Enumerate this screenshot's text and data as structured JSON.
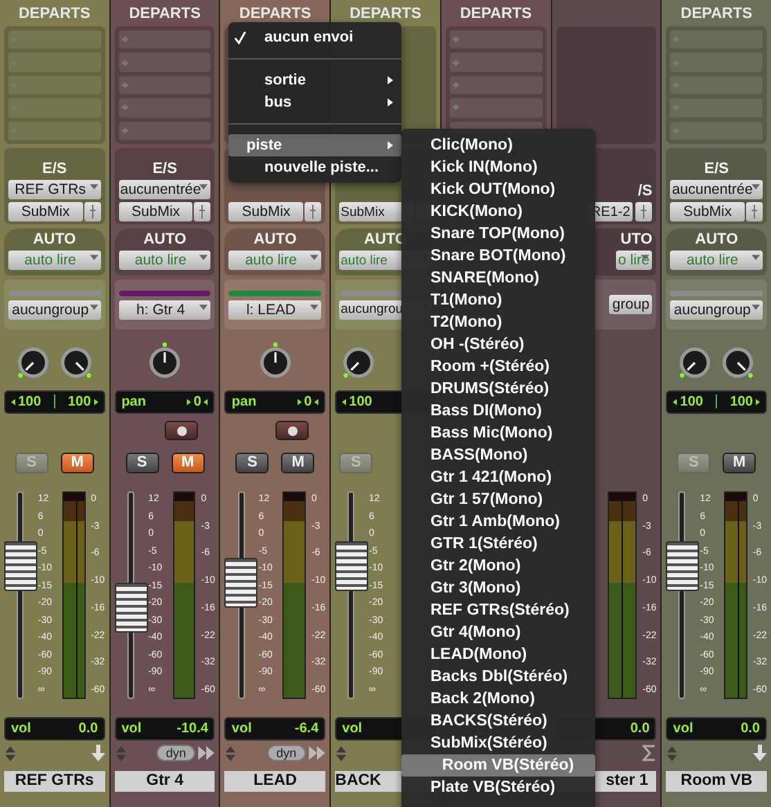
{
  "strips": [
    {
      "color": "#7d7d50",
      "header": "DEPARTS",
      "sends": [
        {
          "kind": "slot"
        },
        {
          "kind": "slot"
        },
        {
          "kind": "slot"
        },
        {
          "kind": "slot"
        },
        {
          "kind": "slot"
        }
      ],
      "io_label": "E/S",
      "input": "REF GTRs",
      "output": "SubMix",
      "auto_label": "AUTO",
      "auto": "auto lire",
      "group": {
        "label": "aucungroup",
        "color": "#8c8c8c"
      },
      "knobs": [
        {
          "kind": "left"
        },
        {
          "kind": "right"
        }
      ],
      "pan": {
        "kind": "width",
        "values": [
          "100",
          "100"
        ]
      },
      "solo": {
        "label": "S",
        "disabled": true
      },
      "mute": {
        "label": "M",
        "on": true
      },
      "level": 0.7,
      "fader_scale": [
        "12",
        "6",
        "0",
        "-5",
        "-10",
        "-15",
        "-20",
        "-30",
        "-40",
        "-60",
        "-90",
        "∞"
      ],
      "meter": {
        "kind": "stereo",
        "scale": [
          "0",
          "-3",
          "-6",
          "-10",
          "-16",
          "-22",
          "-32",
          "-60"
        ]
      },
      "vol_label": "vol",
      "vol": "0.0",
      "bottom": {
        "kind": "send"
      },
      "name": "REF GTRs"
    },
    {
      "color": "#6b5053",
      "header": "DEPARTS",
      "sends": [
        {
          "kind": "slot"
        },
        {
          "kind": "slot"
        },
        {
          "kind": "slot"
        },
        {
          "kind": "slot"
        },
        {
          "kind": "slot"
        }
      ],
      "io_label": "E/S",
      "input": "aucunentrée",
      "output": "SubMix",
      "auto_label": "AUTO",
      "auto": "auto lire",
      "group": {
        "label": "h: Gtr 4",
        "color": "#6a1a6a"
      },
      "knobs": [
        {
          "kind": "center"
        }
      ],
      "pan": {
        "kind": "pan",
        "label": "pan",
        "values": [
          "0"
        ]
      },
      "record": true,
      "solo": {
        "label": "S",
        "disabled": false
      },
      "mute": {
        "label": "M",
        "on": true
      },
      "level": 0.45,
      "fader_scale": [
        "12",
        "6",
        "0",
        "-5",
        "-10",
        "-15",
        "-20",
        "-30",
        "-40",
        "-60",
        "-90",
        "∞"
      ],
      "meter": {
        "kind": "mono",
        "scale": [
          "0",
          "-3",
          "-6",
          "-10",
          "-16",
          "-22",
          "-32",
          "-60"
        ]
      },
      "vol_label": "vol",
      "vol": "-10.4",
      "bottom": {
        "kind": "dyn",
        "label": "dyn"
      },
      "name": "Gtr 4"
    },
    {
      "color": "#86685a",
      "header": "DEPARTS",
      "output": "SubMix",
      "auto_label": "AUTO",
      "auto": "auto lire",
      "group": {
        "label": "l: LEAD",
        "color": "#1e8a3a"
      },
      "knobs": [
        {
          "kind": "center"
        }
      ],
      "pan": {
        "kind": "pan",
        "label": "pan",
        "values": [
          "0"
        ]
      },
      "record": true,
      "solo": {
        "label": "S",
        "disabled": false
      },
      "mute": {
        "label": "M",
        "on": false
      },
      "level": 0.6,
      "fader_scale": [
        "12",
        "6",
        "0",
        "-5",
        "-10",
        "-15",
        "-20",
        "-30",
        "-40",
        "-60",
        "-90",
        "∞"
      ],
      "meter": {
        "kind": "mono",
        "scale": [
          "0",
          "-3",
          "-6",
          "-10",
          "-16",
          "-22",
          "-32",
          "-60"
        ]
      },
      "vol_label": "vol",
      "vol": "-6.4",
      "bottom": {
        "kind": "dyn",
        "label": "dyn"
      },
      "name": "LEAD"
    },
    {
      "color": "#7d7d50",
      "clipped_right": true,
      "header": "DEPARTS",
      "output": "SubMix",
      "auto_label": "AUTO",
      "auto": "auto lire",
      "group": {
        "label": "aucungrou",
        "color": "#8c8c8c"
      },
      "knobs": [
        {
          "kind": "left"
        }
      ],
      "pan": {
        "kind": "width",
        "values": [
          "100"
        ]
      },
      "solo": {
        "label": "S",
        "disabled": true
      },
      "level": 0.7,
      "fader_scale": [
        "12",
        "6",
        "0",
        "-5",
        "-10",
        "-15",
        "-20",
        "-30",
        "-40",
        "-60",
        "-90",
        "∞"
      ],
      "vol_label": "vol",
      "bottom": {
        "kind": "updown"
      },
      "name": "BACK"
    },
    {
      "color": "#6b5053",
      "header": "DEPARTS",
      "sends": [
        {
          "kind": "slot"
        },
        {
          "kind": "slot"
        },
        {
          "kind": "slot"
        },
        {
          "kind": "slot"
        },
        {
          "kind": "slot"
        }
      ]
    },
    {
      "color": "#5e4a4d",
      "clipped_left": true,
      "io_label": "/S",
      "output": "RE1-2",
      "auto_label": "UTO",
      "auto": "o lire",
      "group": {
        "label": "group"
      },
      "meter": {
        "kind": "stereo",
        "scale": [
          "0",
          "-3",
          "-6",
          "-10",
          "-16",
          "-22",
          "-32",
          "-60"
        ]
      },
      "vol": "0.0",
      "bottom": {
        "kind": "sum"
      },
      "name": "ster 1"
    },
    {
      "color": "#6b7058",
      "header": "DEPARTS",
      "sends": [
        {
          "kind": "slot"
        },
        {
          "kind": "slot"
        },
        {
          "kind": "slot"
        },
        {
          "kind": "slot"
        },
        {
          "kind": "slot"
        }
      ],
      "io_label": "E/S",
      "input": "aucunentrée",
      "output": "SubMix",
      "auto_label": "AUTO",
      "auto": "auto lire",
      "group": {
        "label": "aucungroup",
        "color": "#8c8c8c"
      },
      "knobs": [
        {
          "kind": "left"
        },
        {
          "kind": "right"
        }
      ],
      "pan": {
        "kind": "width",
        "values": [
          "100",
          "100"
        ]
      },
      "solo": {
        "label": "S",
        "disabled": true
      },
      "mute": {
        "label": "M",
        "on": false
      },
      "level": 0.7,
      "fader_scale": [
        "12",
        "6",
        "0",
        "-5",
        "-10",
        "-15",
        "-20",
        "-30",
        "-40",
        "-60",
        "-90",
        "∞"
      ],
      "meter": {
        "kind": "stereo",
        "scale": [
          "0",
          "-3",
          "-6",
          "-10",
          "-16",
          "-22",
          "-32",
          "-60"
        ]
      },
      "vol_label": "vol",
      "vol": "0.0",
      "bottom": {
        "kind": "send"
      },
      "name": "Room VB"
    }
  ],
  "send_menu": {
    "items": [
      {
        "kind": "item",
        "label": "aucun envoi",
        "checked": true,
        "submenu": false,
        "selected": false
      },
      {
        "kind": "separator"
      },
      {
        "kind": "item",
        "label": "sortie",
        "checked": false,
        "submenu": true,
        "selected": false
      },
      {
        "kind": "item",
        "label": "bus",
        "checked": false,
        "submenu": true,
        "selected": false
      },
      {
        "kind": "separator"
      },
      {
        "kind": "item",
        "label": "piste",
        "checked": false,
        "submenu": true,
        "selected": true
      },
      {
        "kind": "item",
        "label": "nouvelle piste...",
        "checked": false,
        "submenu": false,
        "selected": false
      }
    ]
  },
  "track_menu": {
    "items": [
      {
        "label": "Clic(Mono)",
        "selected": false
      },
      {
        "label": "Kick IN(Mono)",
        "selected": false
      },
      {
        "label": "Kick OUT(Mono)",
        "selected": false
      },
      {
        "label": "KICK(Mono)",
        "selected": false
      },
      {
        "label": "Snare TOP(Mono)",
        "selected": false
      },
      {
        "label": "Snare BOT(Mono)",
        "selected": false
      },
      {
        "label": "SNARE(Mono)",
        "selected": false
      },
      {
        "label": "T1(Mono)",
        "selected": false
      },
      {
        "label": "T2(Mono)",
        "selected": false
      },
      {
        "label": "OH -(Stéréo)",
        "selected": false
      },
      {
        "label": "Room +(Stéréo)",
        "selected": false
      },
      {
        "label": "DRUMS(Stéréo)",
        "selected": false
      },
      {
        "label": "Bass DI(Mono)",
        "selected": false
      },
      {
        "label": "Bass Mic(Mono)",
        "selected": false
      },
      {
        "label": "BASS(Mono)",
        "selected": false
      },
      {
        "label": "Gtr 1 421(Mono)",
        "selected": false
      },
      {
        "label": "Gtr 1 57(Mono)",
        "selected": false
      },
      {
        "label": "Gtr 1 Amb(Mono)",
        "selected": false
      },
      {
        "label": "GTR 1(Stéréo)",
        "selected": false
      },
      {
        "label": "Gtr 2(Mono)",
        "selected": false
      },
      {
        "label": "Gtr 3(Mono)",
        "selected": false
      },
      {
        "label": "REF GTRs(Stéréo)",
        "selected": false
      },
      {
        "label": "Gtr 4(Mono)",
        "selected": false
      },
      {
        "label": "LEAD(Mono)",
        "selected": false
      },
      {
        "label": "Backs Dbl(Stéréo)",
        "selected": false
      },
      {
        "label": "Back 2(Mono)",
        "selected": false
      },
      {
        "label": "BACKS(Stéréo)",
        "selected": false
      },
      {
        "label": "SubMix(Stéréo)",
        "selected": false
      },
      {
        "label": "Room VB(Stéréo)",
        "selected": true
      },
      {
        "label": "Plate VB(Stéréo)",
        "selected": false
      }
    ]
  }
}
